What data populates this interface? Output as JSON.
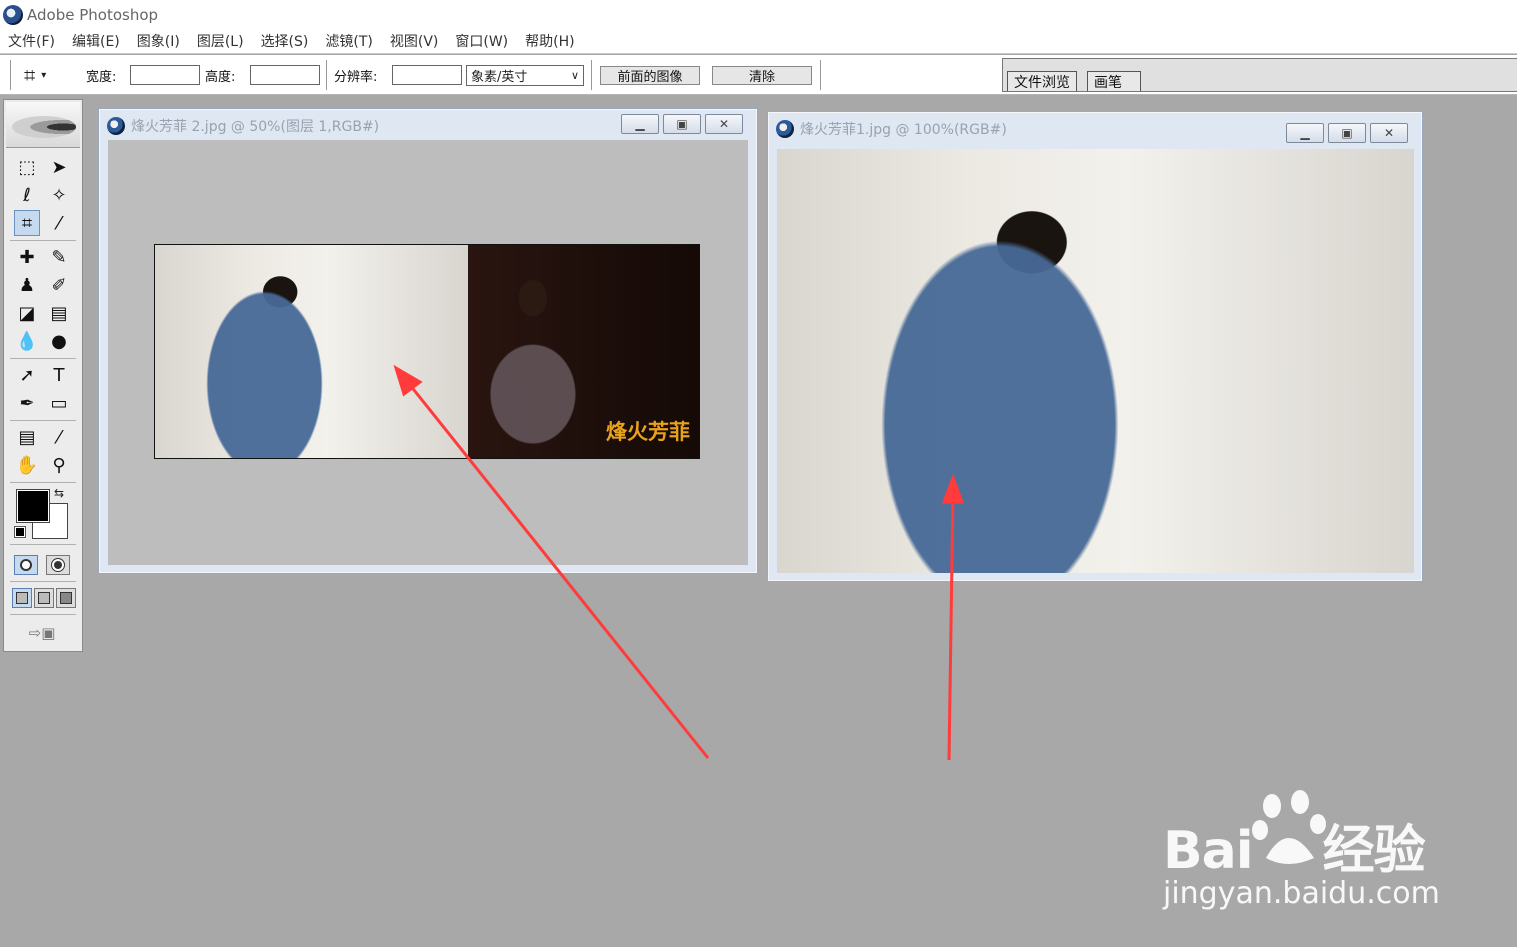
{
  "app": {
    "title": "Adobe Photoshop"
  },
  "menu": [
    "文件(F)",
    "编辑(E)",
    "图象(I)",
    "图层(L)",
    "选择(S)",
    "滤镜(T)",
    "视图(V)",
    "窗口(W)",
    "帮助(H)"
  ],
  "options": {
    "width_label": "宽度:",
    "height_label": "高度:",
    "resolution_label": "分辨率:",
    "unit_select": "象素/英寸",
    "front_image_button": "前面的图像",
    "clear_button": "清除",
    "width_value": "",
    "height_value": "",
    "resolution_value": ""
  },
  "palette_well": {
    "tabs": [
      "文件浏览",
      "画笔"
    ]
  },
  "documents": [
    {
      "title": "烽火芳菲 2.jpg @ 50%(图层 1,RGB#)"
    },
    {
      "title": "烽火芳菲1.jpg @ 100%(RGB#)"
    }
  ],
  "photo_caption": "烽火芳菲",
  "watermark": {
    "brand": "Bai",
    "brand_cn": "经验",
    "site": "jingyan.baidu.com"
  },
  "colors": {
    "foreground": "#000000",
    "background": "#ffffff",
    "arrow": "#ff3b3b"
  }
}
